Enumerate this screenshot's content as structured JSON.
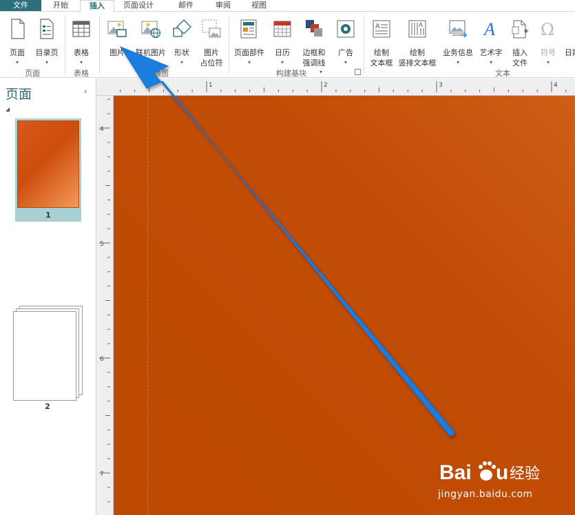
{
  "tabs": [
    "文件",
    "开始",
    "插入",
    "页面设计",
    "邮件",
    "审阅",
    "视图"
  ],
  "ribbon": {
    "groups": {
      "pages": "页面",
      "tables": "表格",
      "illustrations": "插图",
      "building_blocks": "构建基块",
      "text": "文本"
    },
    "buttons": {
      "page": "页面",
      "toc_page": "目录页",
      "table": "表格",
      "picture": "图片",
      "online_picture": "联机图片",
      "shapes": "形状",
      "picture_placeholder_1": "图片",
      "picture_placeholder_2": "占位符",
      "page_parts": "页面部件",
      "calendar": "日历",
      "borders_1": "边框和",
      "borders_2": "强调线",
      "ads": "广告",
      "draw_textbox_1": "绘制",
      "draw_textbox_2": "文本框",
      "draw_vtextbox_1": "绘制",
      "draw_vtextbox_2": "竖排文本框",
      "business_info": "业务信息",
      "wordart": "艺术字",
      "insert_file_1": "插入",
      "insert_file_2": "文件",
      "symbol": "符号",
      "date_truncated": "日期"
    }
  },
  "pages_pane": {
    "title": "页面",
    "pages": [
      {
        "number": "1"
      },
      {
        "number": "2"
      }
    ]
  },
  "ruler": {
    "horizontal_labels": [
      "1",
      "2",
      "3",
      "4"
    ],
    "vertical_labels": [
      "4",
      "5",
      "6",
      "7"
    ]
  },
  "watermark": {
    "url": "jingyan.baidu.com",
    "brand": "Baidu经验"
  },
  "colors": {
    "accent": "#2b6e7c",
    "page_background": "#c14c06",
    "arrow": "#1f7de0"
  }
}
